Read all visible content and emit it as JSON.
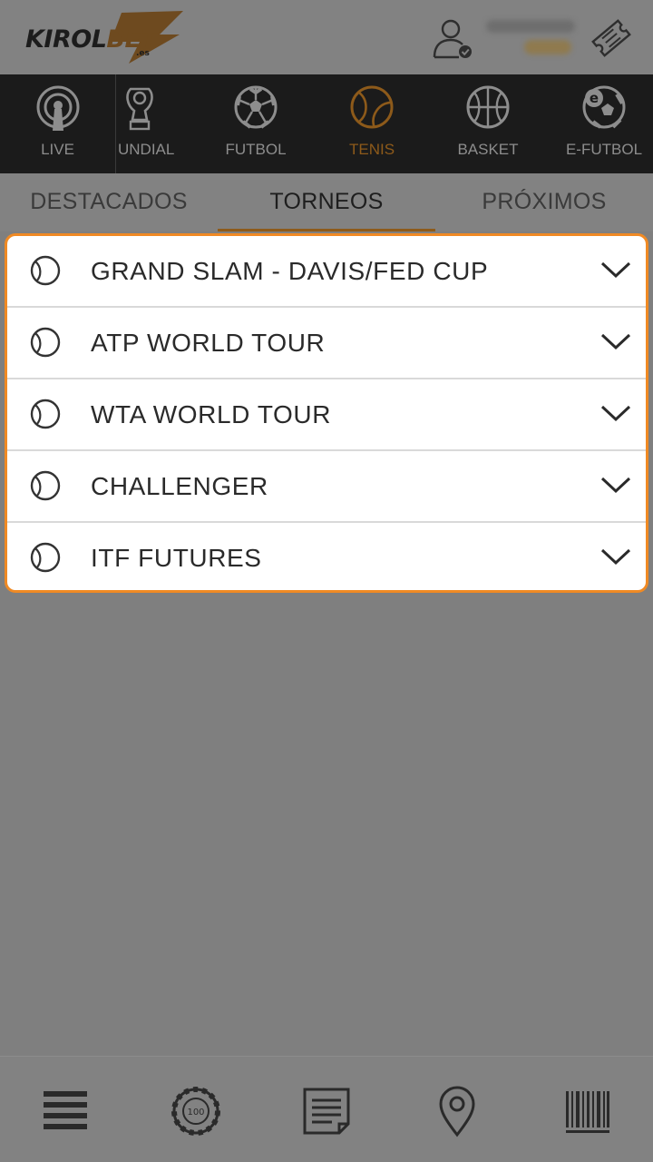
{
  "header": {
    "logo_main": "KIROL",
    "logo_accent": "BET",
    "logo_suffix": ".es",
    "icons": [
      "user-verified-icon",
      "ticket-icon"
    ]
  },
  "sports": [
    {
      "label": "LIVE",
      "icon": "live-broadcast-icon",
      "active": false
    },
    {
      "label": "UNDIAL",
      "icon": "world-cup-trophy-icon",
      "active": false
    },
    {
      "label": "FUTBOL",
      "icon": "soccer-ball-icon",
      "active": false
    },
    {
      "label": "TENIS",
      "icon": "tennis-ball-icon",
      "active": true
    },
    {
      "label": "BASKET",
      "icon": "basketball-icon",
      "active": false
    },
    {
      "label": "E-FUTBOL",
      "icon": "e-soccer-icon",
      "active": false
    }
  ],
  "tabs": [
    {
      "label": "DESTACADOS",
      "active": false
    },
    {
      "label": "TORNEOS",
      "active": true
    },
    {
      "label": "PRÓXIMOS",
      "active": false
    }
  ],
  "tournaments": [
    {
      "label": "GRAND SLAM - DAVIS/FED CUP"
    },
    {
      "label": "ATP WORLD TOUR"
    },
    {
      "label": "WTA WORLD TOUR"
    },
    {
      "label": "CHALLENGER"
    },
    {
      "label": "ITF FUTURES"
    }
  ],
  "bottom_nav": [
    "menu-icon",
    "casino-chip-icon",
    "bet-slip-icon",
    "location-pin-icon",
    "barcode-icon"
  ],
  "colors": {
    "accent": "#f08a24",
    "active_dim": "#8d5a1a",
    "overlay_bg": "#7f7f7f",
    "nav_dark": "#1b1b1b"
  }
}
